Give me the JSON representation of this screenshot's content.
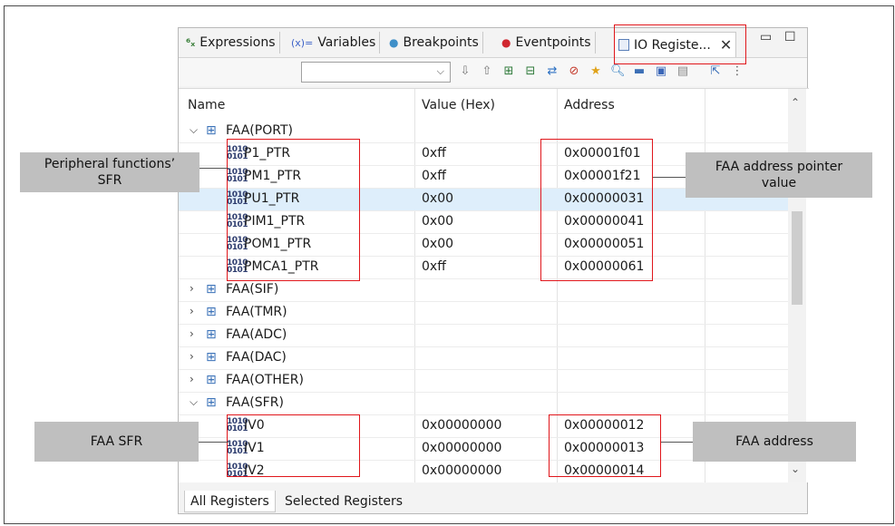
{
  "tabs": [
    {
      "label": "Expressions",
      "icon": "expressions-icon"
    },
    {
      "label": "Variables",
      "icon": "variables-icon",
      "prefix": "(x)="
    },
    {
      "label": "Breakpoints",
      "icon": "breakpoints-icon"
    },
    {
      "label": "Eventpoints",
      "icon": "eventpoints-icon"
    },
    {
      "label": "IO Registe...",
      "icon": "io-registers-icon",
      "active": true
    }
  ],
  "columns": {
    "name": "Name",
    "value": "Value (Hex)",
    "address": "Address"
  },
  "rows": [
    {
      "name": "FAA(PORT)",
      "type": "group",
      "expanded": true
    },
    {
      "name": "P1_PTR",
      "value": "0xff",
      "address": "0x00001f01"
    },
    {
      "name": "PM1_PTR",
      "value": "0xff",
      "address": "0x00001f21"
    },
    {
      "name": "PU1_PTR",
      "value": "0x00",
      "address": "0x00000031",
      "selected": true
    },
    {
      "name": "PIM1_PTR",
      "value": "0x00",
      "address": "0x00000041"
    },
    {
      "name": "POM1_PTR",
      "value": "0x00",
      "address": "0x00000051"
    },
    {
      "name": "PMCA1_PTR",
      "value": "0xff",
      "address": "0x00000061"
    },
    {
      "name": "FAA(SIF)",
      "type": "group",
      "expanded": false
    },
    {
      "name": "FAA(TMR)",
      "type": "group",
      "expanded": false
    },
    {
      "name": "FAA(ADC)",
      "type": "group",
      "expanded": false
    },
    {
      "name": "FAA(DAC)",
      "type": "group",
      "expanded": false
    },
    {
      "name": "FAA(OTHER)",
      "type": "group",
      "expanded": false
    },
    {
      "name": "FAA(SFR)",
      "type": "group",
      "expanded": true
    },
    {
      "name": "IV0",
      "value": "0x00000000",
      "address": "0x00000012"
    },
    {
      "name": "IV1",
      "value": "0x00000000",
      "address": "0x00000013"
    },
    {
      "name": "IV2",
      "value": "0x00000000",
      "address": "0x00000014"
    }
  ],
  "bottom_tabs": [
    "All Registers",
    "Selected Registers"
  ],
  "callouts": {
    "peripheral": "Peripheral functions’ SFR",
    "faa_pointer": "FAA address pointer value",
    "faa_sfr": "FAA SFR",
    "faa_address": "FAA address"
  },
  "colors": {
    "highlight_box": "#e0161b",
    "callout_bg": "#bfbfbf",
    "selection": "#deeefb"
  }
}
